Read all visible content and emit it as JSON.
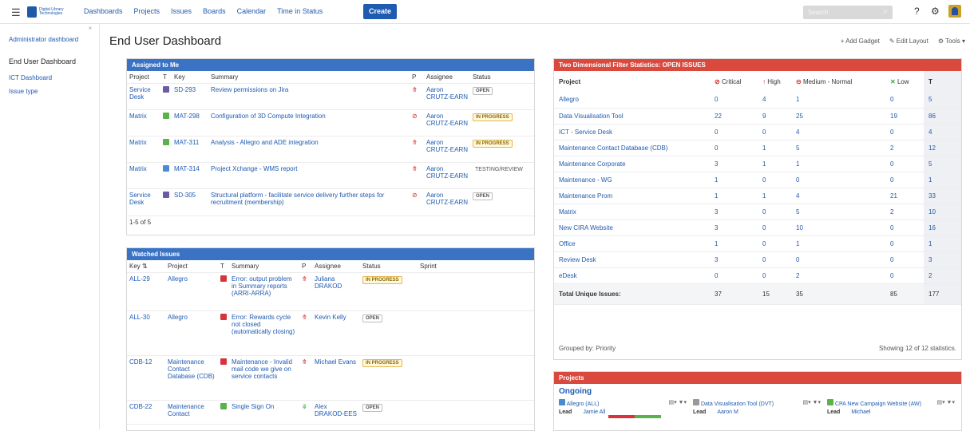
{
  "brand": {
    "logo_text": "Digital Library Technologies",
    "accent": "#1f5bb0"
  },
  "nav": {
    "items": [
      "Dashboards",
      "Projects",
      "Issues",
      "Boards",
      "Calendar",
      "Time in Status"
    ],
    "create": "Create"
  },
  "search": {
    "placeholder": "Search"
  },
  "sidebar": {
    "items": [
      "Administrator dashboard",
      "End User Dashboard",
      "ICT Dashboard",
      "Issue type"
    ],
    "active": "End User Dashboard"
  },
  "page": {
    "title": "End User Dashboard",
    "actions": [
      "Add Gadget",
      "Edit Layout",
      "Tools"
    ]
  },
  "assigned": {
    "title": "Assigned to Me",
    "headers": [
      "Project",
      "T",
      "Key",
      "Summary",
      "P",
      "Assignee",
      "Status"
    ],
    "rows": [
      {
        "project": "Service Desk",
        "key": "SD-293",
        "summary": "Review permissions on Jira",
        "assignee": "Aaron CRUTZ-EARN",
        "status": "OPEN"
      },
      {
        "project": "Matrix",
        "key": "MAT-298",
        "summary": "Configuration of 3D Compute Integration",
        "assignee": "Aaron CRUTZ-EARN",
        "status": "IN PROGRESS"
      },
      {
        "project": "Matrix",
        "key": "MAT-311",
        "summary": "Analysis - Allegro and ADE integration",
        "assignee": "Aaron CRUTZ-EARN",
        "status": "IN PROGRESS"
      },
      {
        "project": "Matrix",
        "key": "MAT-314",
        "summary": "Project Xchange - WMS report",
        "assignee": "Aaron CRUTZ-EARN",
        "status": "TESTING/REVIEW"
      },
      {
        "project": "Service Desk",
        "key": "SD-305",
        "summary": "Structural platform - facilitate service delivery further steps for recruitment (membership)",
        "assignee": "Aaron CRUTZ-EARN",
        "status": "OPEN"
      }
    ],
    "footer": "1-5 of 5"
  },
  "watched": {
    "title": "Watched Issues",
    "headers": [
      "Key",
      "Project",
      "T",
      "Summary",
      "P",
      "Assignee",
      "Status",
      "Sprint"
    ],
    "rows": [
      {
        "key": "ALL-29",
        "project": "Allegro",
        "summary": "Error: output problem in Summary reports (ARRI-ARRA)",
        "assignee": "Juliana DRAKOD",
        "status": "IN PROGRESS",
        "type": "bug",
        "pri": "high"
      },
      {
        "key": "ALL-30",
        "project": "Allegro",
        "summary": "Error: Rewards cycle not closed (automatically closing)",
        "assignee": "Kevin Kelly",
        "status": "OPEN",
        "type": "bug",
        "pri": "high"
      },
      {
        "key": "CDB-12",
        "project": "Maintenance Contact Database (CDB)",
        "summary": "Maintenance - Invalid mail code we give on service contacts",
        "assignee": "Michael Evans",
        "status": "IN PROGRESS",
        "type": "bug",
        "pri": "med"
      },
      {
        "key": "CDB-22",
        "project": "Maintenance Contact",
        "summary": "Single Sign On",
        "assignee": "Alex DRAKOD-EES",
        "status": "OPEN",
        "type": "story",
        "pri": "low"
      }
    ]
  },
  "stats": {
    "title": "Two Dimensional Filter Statistics: OPEN ISSUES",
    "headers": [
      "Project",
      "Critical",
      "High",
      "Medium - Normal",
      "Low",
      "T"
    ],
    "rows": [
      {
        "project": "Allegro",
        "critical": "0",
        "high": "4",
        "medium": "1",
        "low": "0",
        "total": "5"
      },
      {
        "project": "Data Visualisation Tool",
        "critical": "22",
        "high": "9",
        "medium": "25",
        "low": "19",
        "total": "86"
      },
      {
        "project": "ICT - Service Desk",
        "critical": "0",
        "high": "0",
        "medium": "4",
        "low": "0",
        "total": "4"
      },
      {
        "project": "Maintenance Contact Database (CDB)",
        "critical": "0",
        "high": "1",
        "medium": "5",
        "low": "2",
        "total": "12"
      },
      {
        "project": "Maintenance Corporate",
        "critical": "3",
        "high": "1",
        "medium": "1",
        "low": "0",
        "total": "5"
      },
      {
        "project": "Maintenance - WG",
        "critical": "1",
        "high": "0",
        "medium": "0",
        "low": "0",
        "total": "1"
      },
      {
        "project": "Maintenance Prom",
        "critical": "1",
        "high": "1",
        "medium": "4",
        "low": "21",
        "total": "33"
      },
      {
        "project": "Matrix",
        "critical": "3",
        "high": "0",
        "medium": "5",
        "low": "2",
        "total": "10"
      },
      {
        "project": "New CIRA Website",
        "critical": "3",
        "high": "0",
        "medium": "10",
        "low": "0",
        "total": "16"
      },
      {
        "project": "Office",
        "critical": "1",
        "high": "0",
        "medium": "1",
        "low": "0",
        "total": "1"
      },
      {
        "project": "Review Desk",
        "critical": "3",
        "high": "0",
        "medium": "0",
        "low": "0",
        "total": "3"
      },
      {
        "project": "eDesk",
        "critical": "0",
        "high": "0",
        "medium": "2",
        "low": "0",
        "total": "2"
      }
    ],
    "total_label": "Total Unique Issues:",
    "totals": {
      "critical": "37",
      "high": "15",
      "medium": "35",
      "low": "85",
      "total": "177"
    },
    "grouped": "Grouped by: Priority",
    "showing": "Showing 12 of 12 statistics."
  },
  "projects": {
    "title": "Projects",
    "section": "Ongoing",
    "cards": [
      {
        "name": "Allegro (ALL)",
        "lead_label": "Lead",
        "lead": "Jamie All"
      },
      {
        "name": "Data Visualisation Tool (DVT)",
        "lead_label": "Lead",
        "lead": "Aaron M"
      },
      {
        "name": "CPA New Campaign Website (AW)",
        "lead_label": "Lead",
        "lead": "Michael"
      }
    ]
  }
}
